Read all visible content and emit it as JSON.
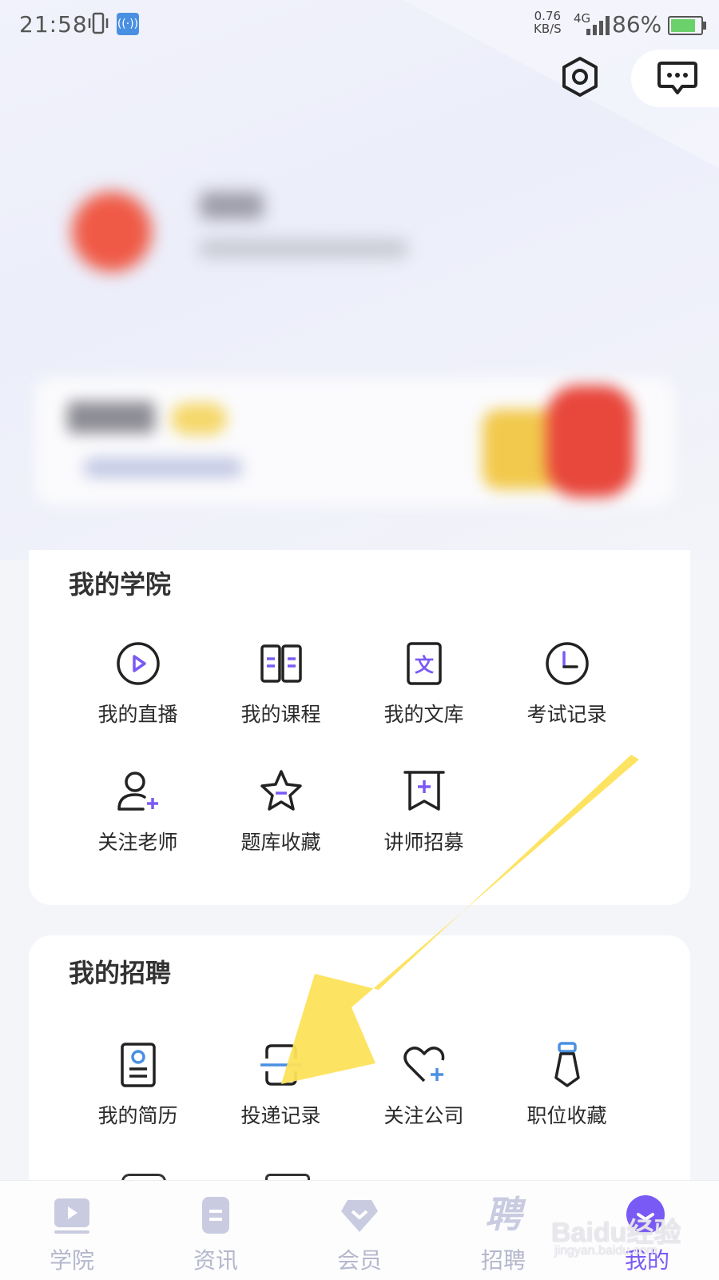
{
  "status_bar": {
    "time": "21:58",
    "net_speed": "0.76",
    "net_unit": "KB/S",
    "network": "4G",
    "battery": "86%"
  },
  "header": {
    "settings_icon": "settings-icon",
    "message_icon": "message-icon"
  },
  "academy": {
    "title": "我的学院",
    "items": [
      {
        "label": "我的直播",
        "icon": "live-play-icon"
      },
      {
        "label": "我的课程",
        "icon": "course-book-icon"
      },
      {
        "label": "我的文库",
        "icon": "library-doc-icon"
      },
      {
        "label": "考试记录",
        "icon": "clock-icon"
      },
      {
        "label": "关注老师",
        "icon": "follow-teacher-icon"
      },
      {
        "label": "题库收藏",
        "icon": "star-icon"
      },
      {
        "label": "讲师招募",
        "icon": "bookmark-plus-icon"
      }
    ]
  },
  "recruit": {
    "title": "我的招聘",
    "items": [
      {
        "label": "我的简历",
        "icon": "resume-icon"
      },
      {
        "label": "投递记录",
        "icon": "scan-record-icon"
      },
      {
        "label": "关注公司",
        "icon": "heart-plus-icon"
      },
      {
        "label": "职位收藏",
        "icon": "tie-icon"
      }
    ]
  },
  "tabbar": {
    "tabs": [
      {
        "label": "学院",
        "icon": "video-play-icon"
      },
      {
        "label": "资讯",
        "icon": "news-icon"
      },
      {
        "label": "会员",
        "icon": "diamond-icon"
      },
      {
        "label": "招聘",
        "glyph": "聘"
      },
      {
        "label": "我的",
        "icon": "me-icon"
      }
    ],
    "active_color": "#7a5af5",
    "inactive_color": "#b4b8cc"
  },
  "watermark": {
    "text": "Baidu经验",
    "sub": "jingyan.baidu.com"
  },
  "colors": {
    "accent": "#7a5af5",
    "annotation_arrow": "#fde15a"
  }
}
